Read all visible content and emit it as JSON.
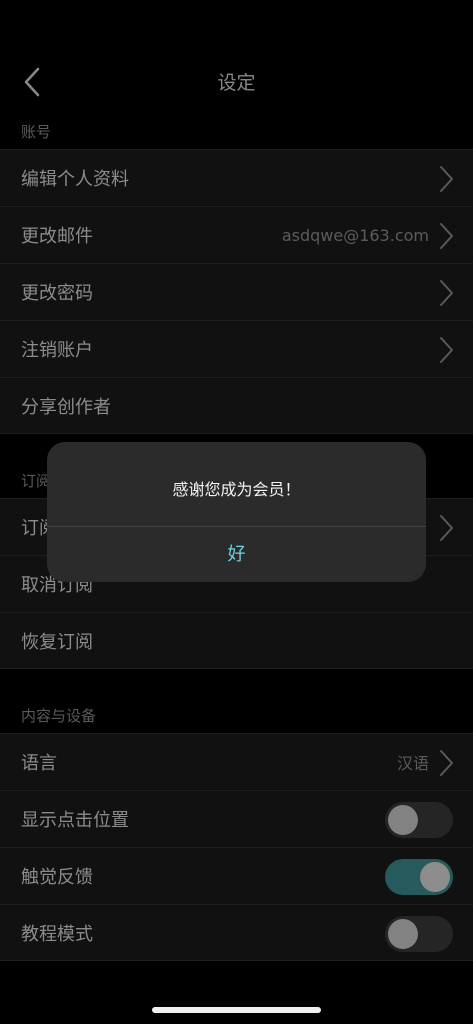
{
  "header": {
    "title": "设定",
    "back_icon": "chevron-left-icon"
  },
  "account": {
    "section_label": "账号",
    "rows": [
      {
        "label": "编辑个人资料",
        "value": "",
        "chevron": true
      },
      {
        "label": "更改邮件",
        "value": "asdqwe@163.com",
        "chevron": true
      },
      {
        "label": "更改密码",
        "value": "",
        "chevron": true
      },
      {
        "label": "注销账户",
        "value": "",
        "chevron": true
      },
      {
        "label": "分享创作者",
        "value": "",
        "chevron": false
      }
    ]
  },
  "subscription": {
    "section_label": "订阅",
    "rows": [
      {
        "label": "订阅",
        "value": "",
        "chevron": true
      },
      {
        "label": "取消订阅",
        "value": "",
        "chevron": false
      },
      {
        "label": "恢复订阅",
        "value": "",
        "chevron": false
      }
    ]
  },
  "content_devices": {
    "section_label": "内容与设备",
    "rows": [
      {
        "label": "语言",
        "value": "汉语",
        "chevron": true
      },
      {
        "label": "显示点击位置",
        "toggle": false
      },
      {
        "label": "触觉反馈",
        "toggle": true
      },
      {
        "label": "教程模式",
        "toggle": false
      }
    ]
  },
  "dialog": {
    "message": "感谢您成为会员！",
    "ok_label": "好"
  },
  "colors": {
    "background": "#000000",
    "row_background": "#1b1b1b",
    "accent": "#6fd0db",
    "toggle_on": "#3d8a8e"
  }
}
